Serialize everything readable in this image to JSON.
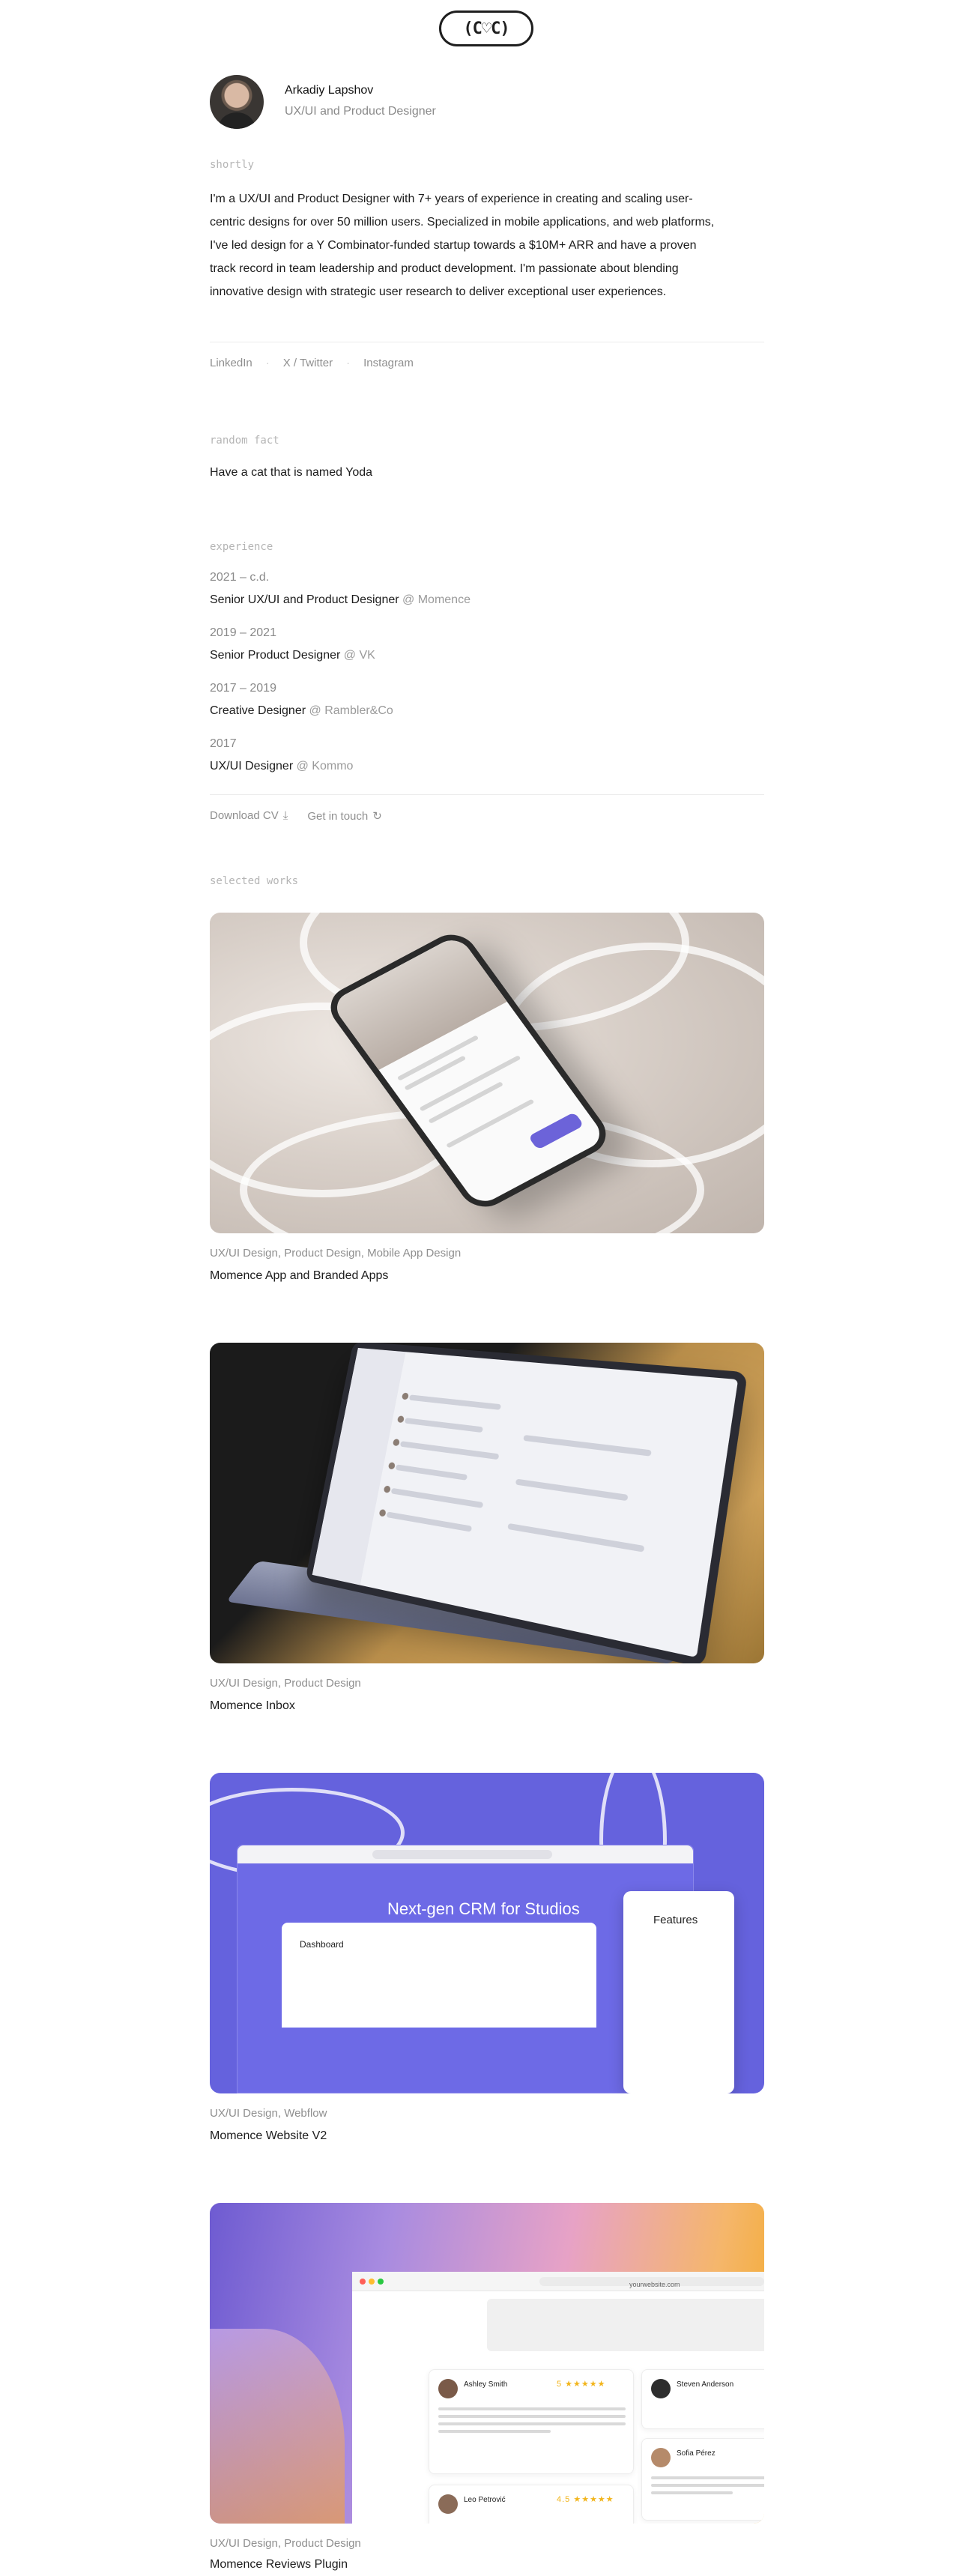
{
  "logo": {
    "text": "(C♡C)"
  },
  "profile": {
    "name": "Arkadiy Lapshov",
    "role": "UX/UI and Product Designer"
  },
  "sections": {
    "shortly": "shortly",
    "random_fact": "random fact",
    "experience": "experience",
    "selected_works": "selected works"
  },
  "bio": "I'm a UX/UI and Product Designer with 7+ years of experience in creating and scaling user-centric designs for over 50 million users. Specialized in mobile applications, and web platforms, I've led design for a Y Combinator-funded startup towards a $10M+ ARR and have a proven track record in team leadership and product development. I'm passionate about blending innovative design with strategic user research to deliver exceptional user experiences.",
  "social": {
    "linkedin": "LinkedIn",
    "twitter": "X / Twitter",
    "instagram": "Instagram"
  },
  "fact": "Have a cat that is named Yoda",
  "experience": [
    {
      "years": "2021 – c.d.",
      "title": "Senior UX/UI and Product Designer",
      "company": "@ Momence"
    },
    {
      "years": "2019 – 2021",
      "title": "Senior Product Designer",
      "company": "@ VK"
    },
    {
      "years": "2017 – 2019",
      "title": "Creative Designer",
      "company": "@ Rambler&Co"
    },
    {
      "years": "2017",
      "title": "UX/UI Designer",
      "company": "@ Kommo"
    }
  ],
  "cta": {
    "download": "Download CV",
    "contact": "Get in touch"
  },
  "works": [
    {
      "tags": "UX/UI Design, Product Design, Mobile App Design",
      "title": "Momence App and Branded Apps"
    },
    {
      "tags": "UX/UI Design, Product Design",
      "title": "Momence Inbox"
    },
    {
      "tags": "UX/UI Design, Webflow",
      "title": "Momence Website V2",
      "headline": "Next-gen CRM for Studios",
      "dashboard": "Dashboard",
      "features": "Features"
    },
    {
      "tags": "UX/UI Design, Product Design",
      "title": "Momence Reviews Plugin",
      "url": "yourwebsite.com",
      "reviews": [
        {
          "name": "Ashley Smith",
          "rating": "5"
        },
        {
          "name": "Steven Anderson",
          "rating": ""
        },
        {
          "name": "Sofia Pérez",
          "rating": ""
        },
        {
          "name": "Leo Petrović",
          "rating": "4.5"
        }
      ]
    }
  ],
  "colors": {
    "accent": "#6562dd",
    "muted": "#8f8f8f",
    "text": "#1c1c1c"
  }
}
